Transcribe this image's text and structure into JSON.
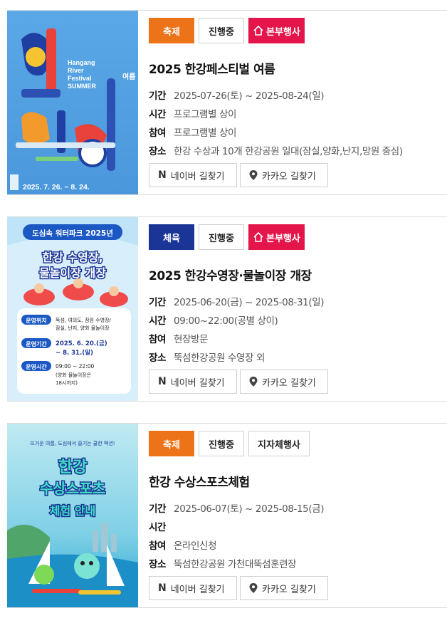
{
  "events": [
    {
      "category": "축제",
      "status": "진행중",
      "host": "본부행사",
      "title": "2025 한강페스티벌 여름",
      "period_label": "기간",
      "period": "2025-07-26(토) ~ 2025-08-24(일)",
      "time_label": "시간",
      "time": "프로그램별 상이",
      "participation_label": "참여",
      "participation": "프로그램별 상이",
      "place_label": "장소",
      "place": "한강 수상과 10개 한강공원 일대(잠실,양화,난지,망원 중심)",
      "poster": {
        "line1": "Hangang",
        "line2": "River",
        "line3": "Festival",
        "line4": "SUMMER",
        "season": "여름",
        "dates": "2025. 7. 26. ~ 8. 24."
      }
    },
    {
      "category": "체육",
      "status": "진행중",
      "host": "본부행사",
      "title": "2025 한강수영장·물놀이장 개장",
      "period_label": "기간",
      "period": "2025-06-20(금) ~ 2025-08-31(일)",
      "time_label": "시간",
      "time": "09:00~22:00(공별 상이)",
      "participation_label": "참여",
      "participation": "현장방문",
      "place_label": "장소",
      "place": "뚝섬한강공원 수영장 외",
      "poster": {
        "top": "도심속 워터파크 2025년",
        "headline1": "한강 수영장,",
        "headline2": "물놀이장 개장",
        "loc_label": "운영위치",
        "loc_1": "뚝섬, 여의도, 잠원 수영장/",
        "loc_2": "잠실, 난지, 양화 물놀이장",
        "period_label": "운영기간",
        "period_1": "2025. 6. 20.(금)",
        "period_2": "~ 8. 31.(일)",
        "hours_label": "운영시간",
        "hours_1": "09:00 ~ 22:00",
        "hours_2": "(양화 물놀이장은",
        "hours_3": "18시까지)"
      }
    },
    {
      "category": "축제",
      "status": "진행중",
      "host": "지자체행사",
      "title": "한강 수상스포츠체험",
      "period_label": "기간",
      "period": "2025-06-07(토) ~ 2025-08-15(금)",
      "time_label": "시간",
      "time": "",
      "participation_label": "참여",
      "participation": "온라인신청",
      "place_label": "장소",
      "place": "뚝섬한강공원 가천대뚝섬훈련장",
      "poster": {
        "top": "뜨거운 여름, 도심에서 즐기는 쿨한 액션!",
        "headline1": "한강",
        "headline2": "수상스포츠",
        "headline3": "체험 안내"
      }
    }
  ],
  "buttons": {
    "naver": "네이버 길찾기",
    "kakao": "카카오 길찾기"
  },
  "colors": {
    "festival": "#ec7317",
    "sports": "#1b3597",
    "host_main": "#e4154a"
  },
  "icons": {
    "naver": "naver-n-icon",
    "kakao": "map-pin-icon",
    "host": "home-icon"
  }
}
